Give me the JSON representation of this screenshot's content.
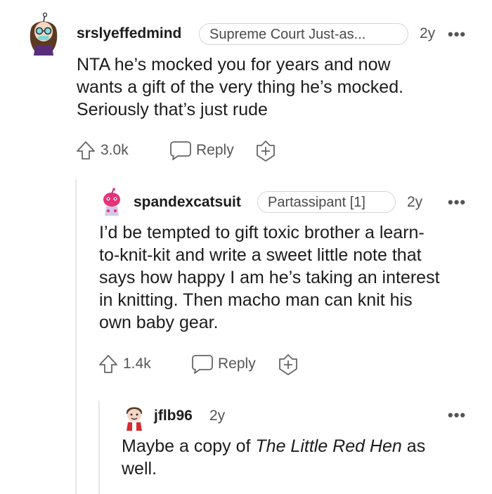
{
  "comments": [
    {
      "username": "srslyeffedmind",
      "flair": "Supreme Court Just-as...",
      "age": "2y",
      "more_label": "•••",
      "body_lines": [
        "NTA he’s mocked you for years and now",
        "wants a gift of the very thing he’s mocked.",
        "Seriously that’s just rude"
      ],
      "votes": "3.0k",
      "reply_label": "Reply"
    },
    {
      "username": "spandexcatsuit",
      "flair": "Partassipant [1]",
      "age": "2y",
      "more_label": "•••",
      "body_lines": [
        "I’d be tempted to gift toxic brother a learn-",
        "to-knit-kit and write a sweet little note that",
        "says how happy I am he’s taking an interest",
        "in knitting. Then macho man can knit his",
        "own baby gear."
      ],
      "votes": "1.4k",
      "reply_label": "Reply"
    },
    {
      "username": "jflb96",
      "age": "2y",
      "more_label": "•••",
      "body_prefix": "Maybe a copy of ",
      "body_italic": "The Little Red Hen",
      "body_suffix": " as",
      "body_line2": "well."
    }
  ],
  "icons": {
    "upvote": "upvote-arrow-icon",
    "reply": "speech-bubble-icon",
    "award": "award-plus-icon",
    "more": "more-options-icon"
  },
  "colors": {
    "text": "#1c1c1c",
    "muted": "#555555",
    "thread_line": "#e6e6e6"
  }
}
